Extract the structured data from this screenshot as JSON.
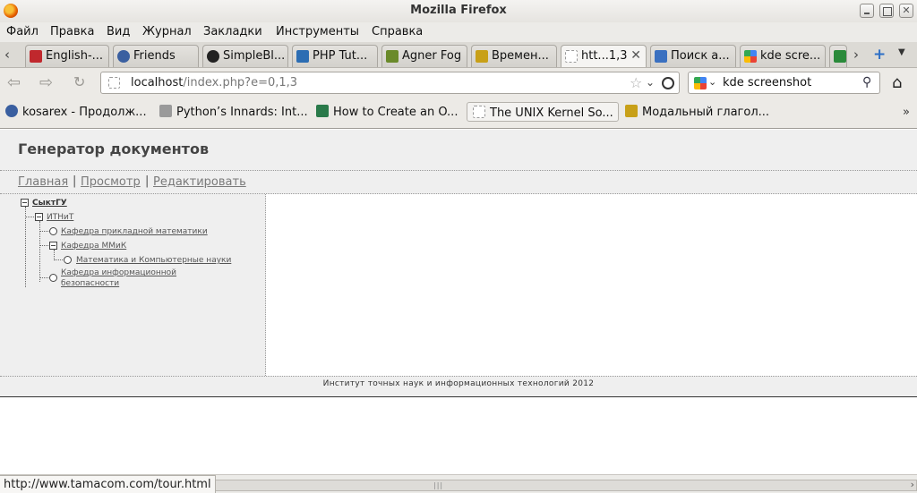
{
  "window": {
    "title": "Mozilla Firefox"
  },
  "menu": [
    "Файл",
    "Правка",
    "Вид",
    "Журнал",
    "Закладки",
    "Инструменты",
    "Справка"
  ],
  "tabs": [
    {
      "label": "English-...",
      "icon": "red-book-icon",
      "color": "#c0282d"
    },
    {
      "label": "Friends",
      "icon": "person-icon",
      "color": "#3a5fa0"
    },
    {
      "label": "SimpleBl...",
      "icon": "github-icon",
      "color": "#222222"
    },
    {
      "label": "PHP Tut...",
      "icon": "tutorial-icon",
      "color": "#2c6db3"
    },
    {
      "label": "Agner Fog",
      "icon": "agner-fog-icon",
      "color": "#6a8a2a"
    },
    {
      "label": "Времен...",
      "icon": "uk-flag-icon",
      "color": "#c8a018"
    },
    {
      "label": "htt...1,3",
      "icon": "blank-page-icon",
      "color": "#ffffff",
      "active": true
    },
    {
      "label": "Поиск а...",
      "icon": "video-icon",
      "color": "#3a70c0"
    },
    {
      "label": "kde scre...",
      "icon": "google-icon",
      "color": "#4285f4"
    },
    {
      "label": "",
      "icon": "chart-icon",
      "color": "#2a8a3a"
    }
  ],
  "nav": {
    "url_host": "localhost",
    "url_path": "/index.php?e=0,1,3",
    "search_text": "kde screenshot"
  },
  "bookmarks": [
    {
      "label": "kosarex - Продолж...",
      "icon": "person-icon",
      "color": "#3a5fa0"
    },
    {
      "label": "Python’s Innards: Int...",
      "icon": "avatar-icon",
      "color": "#9a9a9a"
    },
    {
      "label": "How to Create an O...",
      "icon": "green-square-icon",
      "color": "#2a7a4a"
    },
    {
      "label": "The UNIX Kernel So...",
      "icon": "blank-page-icon",
      "color": "#ffffff"
    },
    {
      "label": "Модальный глагол...",
      "icon": "uk-flag-icon",
      "color": "#c8a018"
    }
  ],
  "page": {
    "title": "Генератор документов",
    "nav": [
      "Главная",
      "Просмотр",
      "Редактировать"
    ],
    "tree": {
      "root": "СыктГУ",
      "child": "ИТНиТ",
      "items": [
        "Кафедра прикладной математики",
        "Кафедра ММиК",
        "Математика и Компьютерные науки",
        "Кафедра информационной",
        "безопасности"
      ]
    },
    "footer": "Институт точных наук и информационных технологий 2012"
  },
  "status": {
    "text": "http://www.tamacom.com/tour.html"
  }
}
